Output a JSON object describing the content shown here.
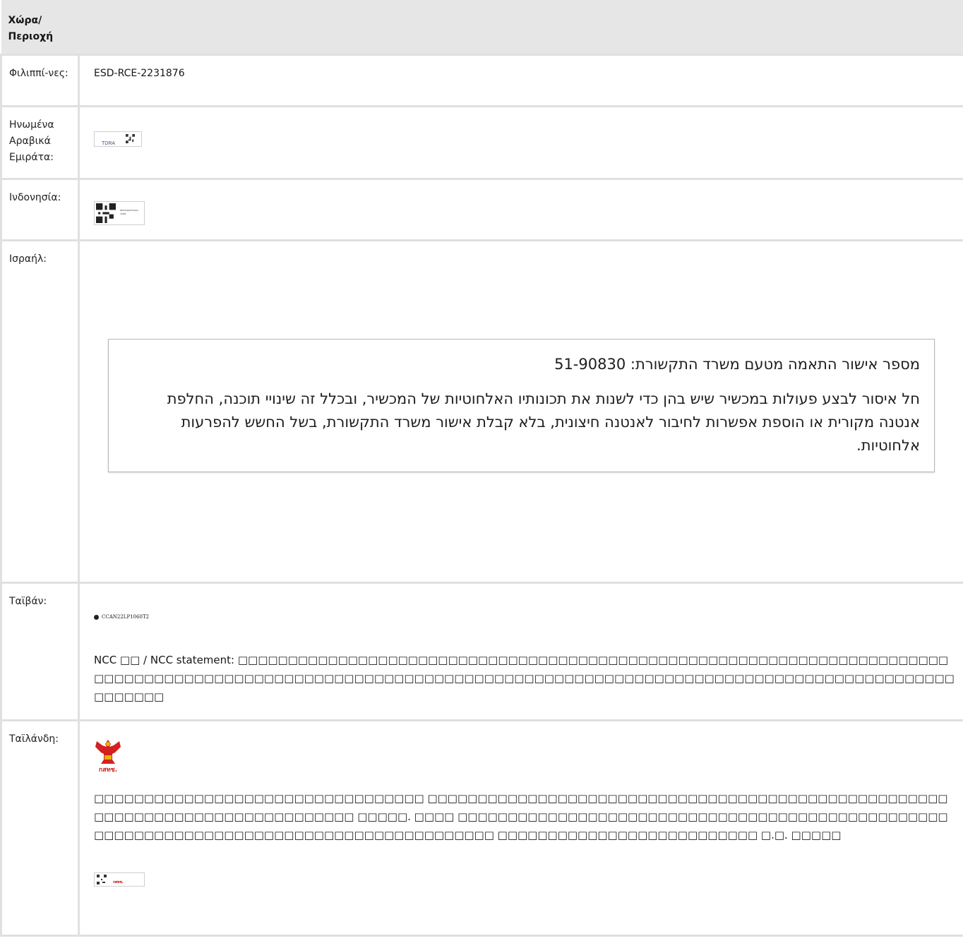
{
  "header": {
    "country_col": "Χώρα/\nΠεριοχή",
    "content_col": ""
  },
  "rows": {
    "philippines": {
      "country": "Φιλιππί-νες:",
      "value": "ESD-RCE-2231876"
    },
    "uae": {
      "country": "Ηνωμένα Αραβικά Εμιράτα:",
      "label_text": "TDRA",
      "icon": "qr-code-icon"
    },
    "indonesia": {
      "country": "Ινδονησία:",
      "label_text": "86575/SDPPI/2023 72808",
      "icon": "qr-code-icon"
    },
    "israel": {
      "country": "Ισραήλ:",
      "line1": "מספר אישור התאמה מטעם משרד התקשורת: 51-90830",
      "line2": "חל איסור לבצע פעולות במכשיר שיש בהן כדי לשנות את תכונותיו האלחוטיות של המכשיר, ובכלל זה שינויי תוכנה, החלפת אנטנה מקורית או הוספת אפשרות לחיבור לאנטנה חיצונית, בלא קבלת אישור משרד התקשורת, בשל החשש להפרעות אלחוטיות."
    },
    "taiwan": {
      "country": "Ταϊβάν:",
      "label_text": "CCAN22LP1060T2",
      "statement": "NCC □□ / NCC statement: □□□□□□□□□□□□□□□□□□□□□□□□□□□□□□□□□□□□□□□□□□□□□□□□□□□□□□□□□□□□□□□□□□□□□□□□□□□□□□□□□□□□□□□□□□□□□□□□□□□□□□□□□□□□□□□□□□□□□□□□□□□□□□□□□□□□□□□□□□□□□□□□□□□□□□□□□□□□□□□□□□□□"
    },
    "thailand": {
      "country": "Ταϊλάνδη:",
      "logo_text": "กสทช.",
      "statement": "□□□□□□□□□□□□□□□□□□□□□□□□□□□□□□□□□ □□□□□□□□□□□□□□□□□□□□□□□□□□□□□□□□□□□□□□□□□□□□□□□□□□□□□□□□□□□□□□□□□□□□□□□□□□□□□□ □□□□□. □□□□ □□□□□□□□□□□□□□□□□□□□□□□□□□□□□□□□□□□□□□□□□□□□□□□□□□□□□□□□□□□□□□□□□□□□□□□□□□□□□□□□□□□□□□□□□ □□□□□□□□□□□□□□□□□□□□□□□□□□ □.□. □□□□□",
      "label_text": "กสทช."
    }
  }
}
